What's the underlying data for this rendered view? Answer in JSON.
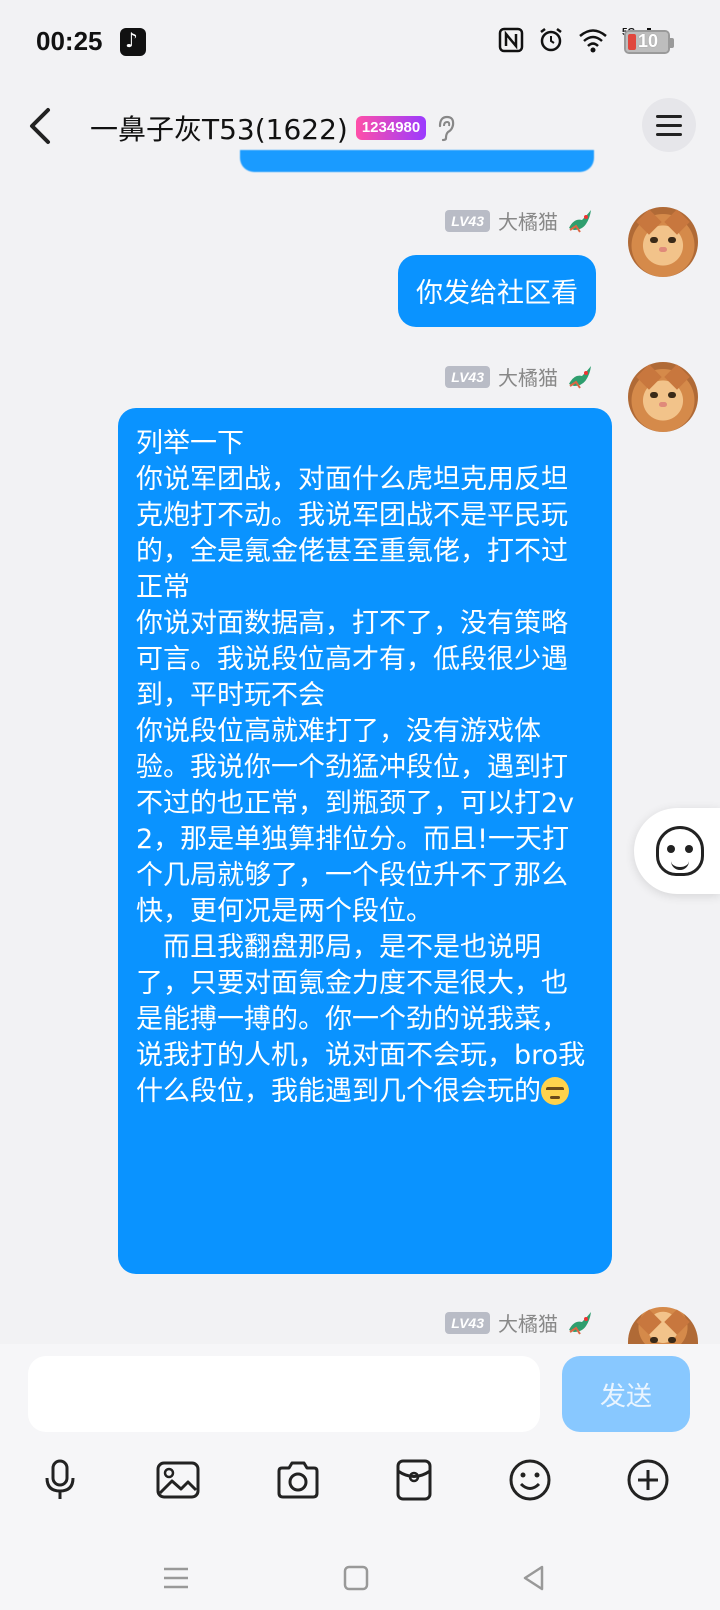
{
  "status_bar": {
    "time": "00:25",
    "battery": "10",
    "network": "5G"
  },
  "header": {
    "title": "一鼻子灰T53(1622)",
    "badge": "1234980"
  },
  "messages": [
    {
      "sender": "大橘猫",
      "level": "LV43",
      "text": "你发给社区看"
    },
    {
      "sender": "大橘猫",
      "level": "LV43",
      "text": "列举一下\n你说军团战，对面什么虎坦克用反坦克炮打不动。我说军团战不是平民玩的，全是氪金佬甚至重氪佬，打不过正常\n你说对面数据高，打不了，没有策略可言。我说段位高才有，低段很少遇到，平时玩不会\n你说段位高就难打了，没有游戏体验。我说你一个劲猛冲段位，遇到打不过的也正常，到瓶颈了，可以打2v2，那是单独算排位分。而且!一天打个几局就够了，一个段位升不了那么快，更何况是两个段位。\n　而且我翻盘那局，是不是也说明了，只要对面氪金力度不是很大，也是能搏一搏的。你一个劲的说我菜，说我打的人机，说对面不会玩，bro我什么段位，我能遇到几个很会玩的"
    },
    {
      "sender": "大橘猫",
      "level": "LV43"
    }
  ],
  "input": {
    "value": "",
    "send_label": "发送"
  },
  "toolbar": {
    "icons": [
      "mic-icon",
      "image-icon",
      "camera-icon",
      "red-packet-icon",
      "emoji-icon",
      "plus-icon"
    ]
  },
  "colors": {
    "bubble": "#0a93ff",
    "send_disabled": "#88c8ff",
    "background": "#f2f2f4"
  }
}
